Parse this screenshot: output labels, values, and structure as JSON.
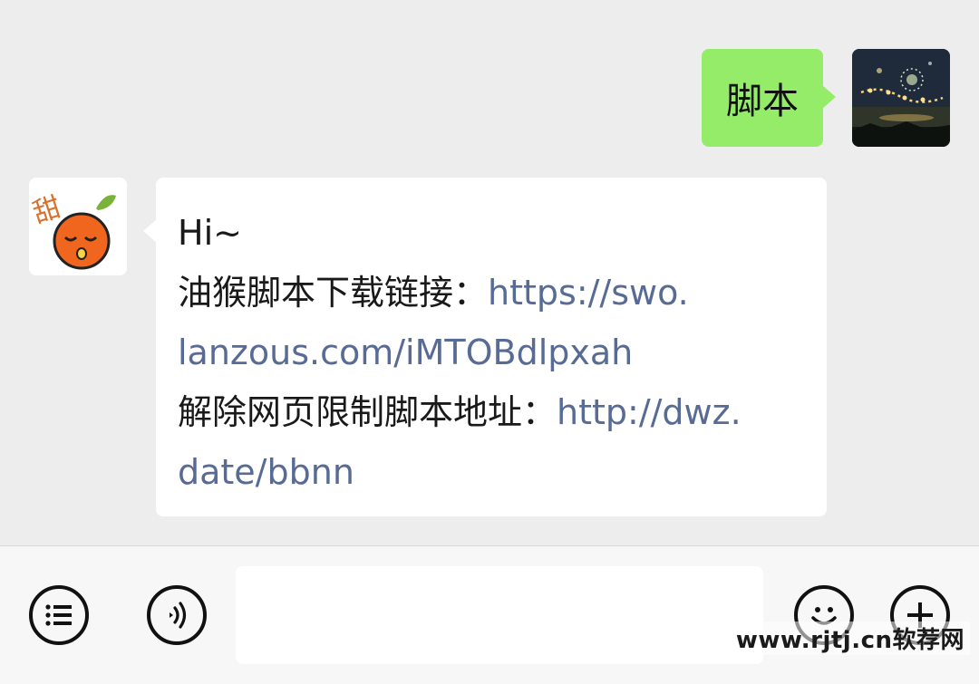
{
  "chat": {
    "self_message": "脚本",
    "other_message": {
      "lines": [
        {
          "text": "Hi~",
          "link": ""
        },
        {
          "text": "油猴脚本下载链接：",
          "link": "https://swo."
        },
        {
          "text": "",
          "link": "lanzous.com/iMTOBdlpxah"
        },
        {
          "text": "解除网页限制脚本地址：",
          "link": "http://dwz."
        },
        {
          "text": "",
          "link": "date/bbnn"
        }
      ]
    },
    "other_avatar_text": "甜"
  },
  "input_bar": {
    "placeholder": "",
    "menu_icon": "list-menu-icon",
    "voice_icon": "voice-icon",
    "emoji_icon": "emoji-icon",
    "plus_icon": "plus-icon"
  },
  "watermark": "www.rjtj.cn软荐网",
  "colors": {
    "self_bubble": "#95ec69",
    "link": "#576b95",
    "background": "#ededed"
  }
}
